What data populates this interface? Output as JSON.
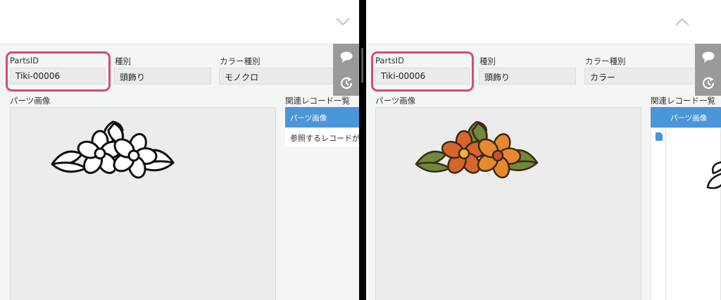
{
  "left": {
    "fields": {
      "parts_id": {
        "label": "PartsID",
        "value": "Tiki-00006"
      },
      "type": {
        "label": "種別",
        "value": "頭飾り"
      },
      "color_type": {
        "label": "カラー種別",
        "value": "モノクロ"
      }
    },
    "parts_image_label": "パーツ画像",
    "related": {
      "title": "関連レコード一覧",
      "tab_label": "パーツ画像",
      "empty_text": "参照するレコードがありません"
    }
  },
  "right": {
    "fields": {
      "parts_id": {
        "label": "PartsID",
        "value": "Tiki-00006"
      },
      "type": {
        "label": "種別",
        "value": "頭飾り"
      },
      "color_type": {
        "label": "カラー種別",
        "value": "カラー"
      }
    },
    "parts_image_label": "パーツ画像",
    "related": {
      "title": "関連レコード一覧",
      "tab_label": "パーツ画像"
    }
  },
  "icons": {
    "collapse_down": "chevron-down-icon",
    "collapse_up": "chevron-up-icon",
    "comment": "comment-icon",
    "history": "history-icon",
    "file": "file-icon"
  },
  "colors": {
    "highlight": "#d64a7a",
    "related_header": "#4b95d9",
    "side_toolbar": "#9a9a9a"
  }
}
